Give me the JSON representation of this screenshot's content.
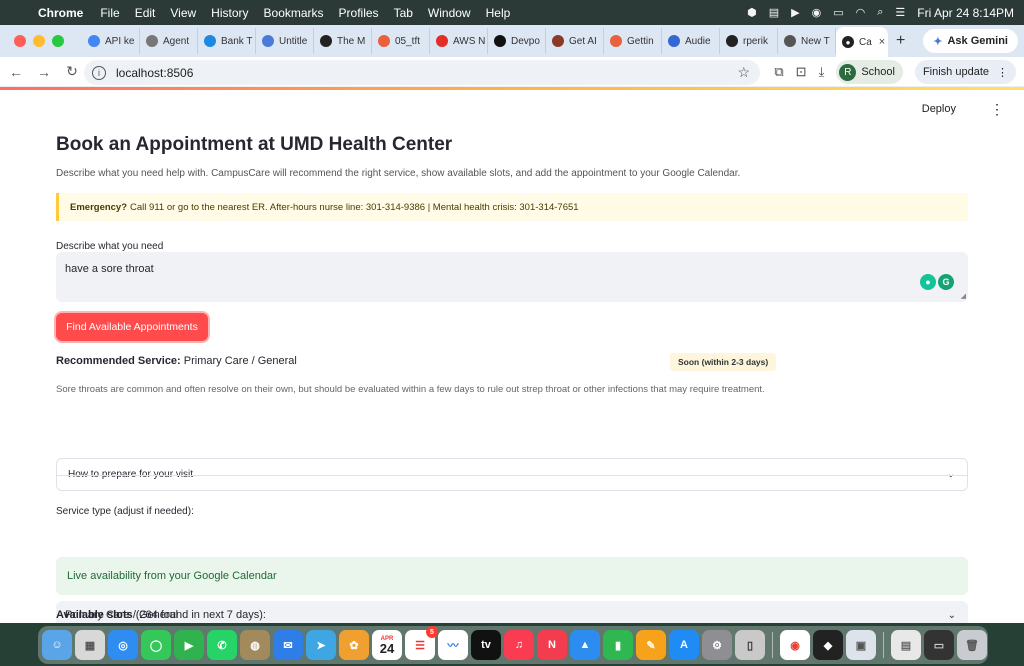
{
  "menubar": {
    "apple": "",
    "app": "Chrome",
    "menus": [
      "File",
      "Edit",
      "View",
      "History",
      "Bookmarks",
      "Profiles",
      "Tab",
      "Window",
      "Help"
    ],
    "datetime": "Fri Apr 24  8:14PM"
  },
  "browser": {
    "tabs": [
      {
        "label": "API ke",
        "color": "#4285f4"
      },
      {
        "label": "Agent",
        "color": "#777777"
      },
      {
        "label": "Bank T",
        "color": "#1e88e5"
      },
      {
        "label": "Untitle",
        "color": "#4a7bd8"
      },
      {
        "label": "The M",
        "color": "#222222"
      },
      {
        "label": "05_tft",
        "color": "#e8603c"
      },
      {
        "label": "AWS N",
        "color": "#e52d27"
      },
      {
        "label": "Devpo",
        "color": "#111111"
      },
      {
        "label": "Get AI",
        "color": "#8b3a2a"
      },
      {
        "label": "Gettin",
        "color": "#e8603c"
      },
      {
        "label": "Audie",
        "color": "#3367d6"
      },
      {
        "label": "rperik",
        "color": "#222222"
      },
      {
        "label": "New T",
        "color": "#555555"
      }
    ],
    "active_tab": {
      "label": "Ca",
      "close": "×"
    },
    "new_tab": "+",
    "ask_gemini": "Ask Gemini",
    "url": "localhost:8506",
    "profile_initial": "R",
    "profile_name": "School",
    "finish_update": "Finish update"
  },
  "app": {
    "deploy": "Deploy",
    "title": "Book an Appointment at UMD Health Center",
    "subtitle": "Describe what you need help with. CampusCare will recommend the right service, show available slots, and add the appointment to your Google Calendar.",
    "emergency_bold": "Emergency?",
    "emergency_text": "Call 911 or go to the nearest ER. After-hours nurse line: 301-314-9386 | Mental health crisis: 301-314-7651",
    "describe_label": "Describe what you need",
    "describe_value": "have a sore throat",
    "find_button": "Find Available Appointments",
    "recommended_label": "Recommended Service:",
    "recommended_value": "Primary Care / General",
    "urgency_badge": "Soon (within 2-3 days)",
    "explanation": "Sore throats are common and often resolve on their own, but should be evaluated within a few days to rule out strep throat or other infections that may require treatment.",
    "prepare_expander": "How to prepare for your visit",
    "service_type_label": "Service type (adjust if needed):",
    "service_type_value": "Primary Care / General",
    "live_availability": "Live availability from your Google Calendar",
    "slots_label": "Available slots",
    "slots_count": "(264 found in next 7 days):"
  },
  "dock": {
    "calendar_month": "APR",
    "calendar_day": "24",
    "reminders_badge": "5"
  }
}
